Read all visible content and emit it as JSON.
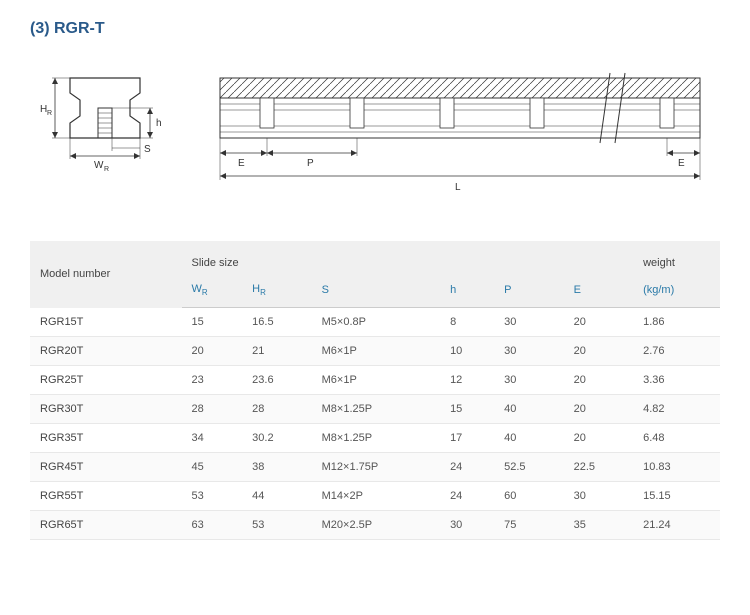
{
  "title": "(3) RGR-T",
  "diagram_labels": {
    "HR": "H",
    "HR_sub": "R",
    "WR": "W",
    "WR_sub": "R",
    "S": "S",
    "h": "h",
    "E": "E",
    "P": "P",
    "L": "L"
  },
  "table": {
    "group_headers": {
      "model": "Model number",
      "slide": "Slide size",
      "weight": "weight"
    },
    "sub_headers": {
      "WR": "W",
      "WR_sub": "R",
      "HR": "H",
      "HR_sub": "R",
      "S": "S",
      "h": "h",
      "P": "P",
      "E": "E",
      "weight_unit": "(kg/m)"
    },
    "rows": [
      {
        "model": "RGR15T",
        "WR": "15",
        "HR": "16.5",
        "S": "M5×0.8P",
        "h": "8",
        "P": "30",
        "E": "20",
        "weight": "1.86"
      },
      {
        "model": "RGR20T",
        "WR": "20",
        "HR": "21",
        "S": "M6×1P",
        "h": "10",
        "P": "30",
        "E": "20",
        "weight": "2.76"
      },
      {
        "model": "RGR25T",
        "WR": "23",
        "HR": "23.6",
        "S": "M6×1P",
        "h": "12",
        "P": "30",
        "E": "20",
        "weight": "3.36"
      },
      {
        "model": "RGR30T",
        "WR": "28",
        "HR": "28",
        "S": "M8×1.25P",
        "h": "15",
        "P": "40",
        "E": "20",
        "weight": "4.82"
      },
      {
        "model": "RGR35T",
        "WR": "34",
        "HR": "30.2",
        "S": "M8×1.25P",
        "h": "17",
        "P": "40",
        "E": "20",
        "weight": "6.48"
      },
      {
        "model": "RGR45T",
        "WR": "45",
        "HR": "38",
        "S": "M12×1.75P",
        "h": "24",
        "P": "52.5",
        "E": "22.5",
        "weight": "10.83"
      },
      {
        "model": "RGR55T",
        "WR": "53",
        "HR": "44",
        "S": "M14×2P",
        "h": "24",
        "P": "60",
        "E": "30",
        "weight": "15.15"
      },
      {
        "model": "RGR65T",
        "WR": "63",
        "HR": "53",
        "S": "M20×2.5P",
        "h": "30",
        "P": "75",
        "E": "35",
        "weight": "21.24"
      }
    ]
  }
}
